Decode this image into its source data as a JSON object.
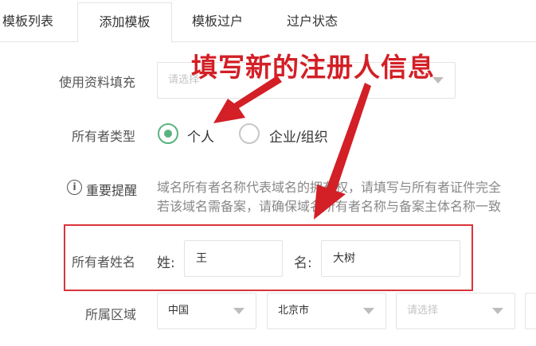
{
  "tabs": [
    {
      "label": "模板列表"
    },
    {
      "label": "添加模板"
    },
    {
      "label": "模板过户"
    },
    {
      "label": "过户状态"
    }
  ],
  "form": {
    "fill_from_profile": {
      "label": "使用资料填充",
      "placeholder": "请选择"
    },
    "owner_type": {
      "label": "所有者类型",
      "options": [
        {
          "label": "个人",
          "selected": true
        },
        {
          "label": "企业/组织",
          "selected": false
        }
      ]
    },
    "notice": {
      "label": "重要提醒",
      "line1": "域名所有者名称代表域名的拥有权，请填写与所有者证件完全",
      "line2": "若该域名需备案，请确保域名所有者名称与备案主体名称一致"
    },
    "owner_name": {
      "label": "所有者姓名",
      "surname_prefix": "姓:",
      "surname_value": "王",
      "given_prefix": "名:",
      "given_value": "大树"
    },
    "region": {
      "label": "所属区域",
      "country": "中国",
      "province": "北京市",
      "city_placeholder": "请选择"
    }
  },
  "annotation": {
    "text": "填写新的注册人信息",
    "color": "#d31f26"
  },
  "colors": {
    "accent_green": "#5ab37f",
    "highlight_red": "#d9343a"
  }
}
